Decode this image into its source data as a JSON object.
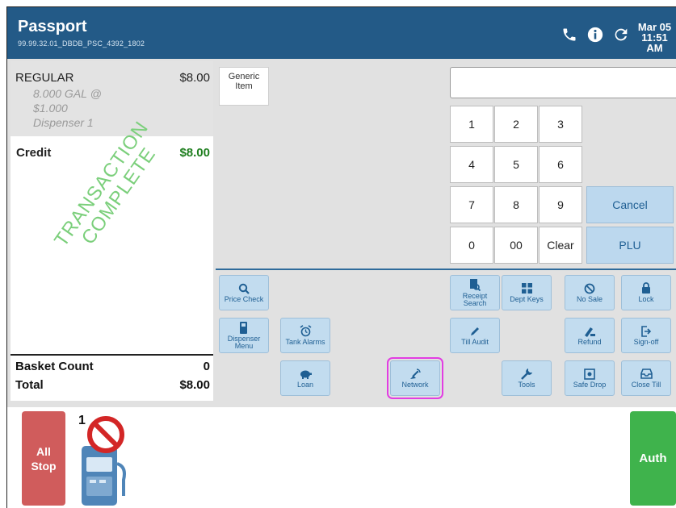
{
  "header": {
    "title": "Passport",
    "version": "99.99.32.01_DBDB_PSC_4392_1802",
    "date": "Mar 05",
    "time": "11:51 AM",
    "icons": [
      "phone-icon",
      "info-icon",
      "refresh-icon"
    ]
  },
  "receipt": {
    "item": {
      "name": "REGULAR",
      "price": "$8.00",
      "detail_line1": "8.000 GAL @",
      "detail_line2": "$1.000",
      "detail_line3": "Dispenser 1"
    },
    "payment": {
      "label": "Credit",
      "amount": "$8.00"
    },
    "stamp_line1": "TRANSACTION",
    "stamp_line2": "COMPLETE",
    "basket_count_label": "Basket Count",
    "basket_count_value": "0",
    "total_label": "Total",
    "total_value": "$8.00"
  },
  "generic_item": {
    "line1": "Generic",
    "line2": "Item"
  },
  "keypad": {
    "display_value": "",
    "keys": [
      "1",
      "2",
      "3",
      "4",
      "5",
      "6",
      "7",
      "8",
      "9",
      "0",
      "00",
      "Clear"
    ],
    "cancel": "Cancel",
    "plu": "PLU"
  },
  "functions": {
    "price_check": "Price Check",
    "dispenser_menu_1": "Dispenser",
    "dispenser_menu_2": "Menu",
    "tank_alarms": "Tank Alarms",
    "loan": "Loan",
    "network": "Network",
    "receipt_search_1": "Receipt",
    "receipt_search_2": "Search",
    "dept_keys": "Dept Keys",
    "no_sale": "No Sale",
    "lock": "Lock",
    "till_audit": "Till Audit",
    "refund": "Refund",
    "sign_off": "Sign-off",
    "tools": "Tools",
    "safe_drop": "Safe Drop",
    "close_till": "Close Till"
  },
  "fuel": {
    "all_stop_1": "All",
    "all_stop_2": "Stop",
    "dispenser_number": "1",
    "auth": "Auth"
  },
  "colors": {
    "header_bg": "#235a87",
    "function_button": "#c2dcef",
    "all_stop": "#d05c5c",
    "auth": "#3fb34c",
    "credit_amount": "#1e7e1e",
    "highlight": "#e23de2"
  }
}
